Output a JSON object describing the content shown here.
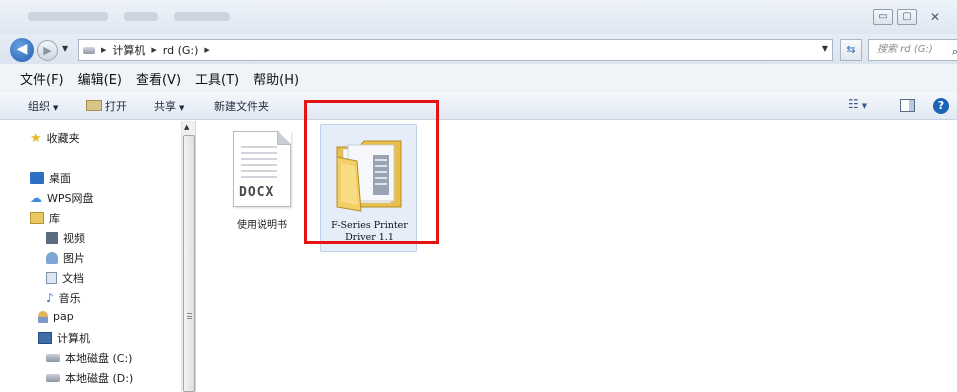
{
  "window": {
    "minimize_glyph": "▭",
    "maximize_glyph": "▢",
    "close_glyph": "✕"
  },
  "nav": {
    "back_glyph": "◀",
    "forward_glyph": "▶",
    "dropdown_glyph": "▼"
  },
  "address": {
    "segments": [
      "计算机",
      "rd (G:)"
    ],
    "separator": "▶"
  },
  "search": {
    "placeholder": "搜索 rd (G:)",
    "icon": "search-icon"
  },
  "menu": {
    "items": [
      "文件(F)",
      "编辑(E)",
      "查看(V)",
      "工具(T)",
      "帮助(H)"
    ]
  },
  "toolbar": {
    "organize": "组织",
    "print": "打开",
    "share": "共享",
    "new_folder": "新建文件夹",
    "caret": "▼",
    "help": "?"
  },
  "sidebar": {
    "items": [
      {
        "label": "收藏夹",
        "icon": "star-icon"
      },
      {
        "label": "桌面",
        "icon": "desktop-icon"
      },
      {
        "label": "WPS网盘",
        "icon": "cloud-icon"
      },
      {
        "label": "库",
        "icon": "library-icon"
      },
      {
        "label": "视频",
        "icon": "video-icon"
      },
      {
        "label": "图片",
        "icon": "picture-icon"
      },
      {
        "label": "文档",
        "icon": "document-icon"
      },
      {
        "label": "音乐",
        "icon": "music-icon"
      },
      {
        "label": "pap",
        "icon": "user-icon"
      },
      {
        "label": "计算机",
        "icon": "computer-icon"
      },
      {
        "label": "本地磁盘 (C:)",
        "icon": "drive-icon"
      },
      {
        "label": "本地磁盘 (D:)",
        "icon": "drive-icon"
      }
    ]
  },
  "files": [
    {
      "name": "使用说明书",
      "type_tag": "DOCX",
      "icon": "docx-file-icon"
    },
    {
      "name_line1": "F-Series Printer",
      "name_line2": "Driver 1.1",
      "icon": "folder-icon",
      "selected": true
    }
  ],
  "colors": {
    "highlight_box": "#e41414",
    "selection_bg": "#e4edf8",
    "folder_yellow": "#f2cf63"
  }
}
